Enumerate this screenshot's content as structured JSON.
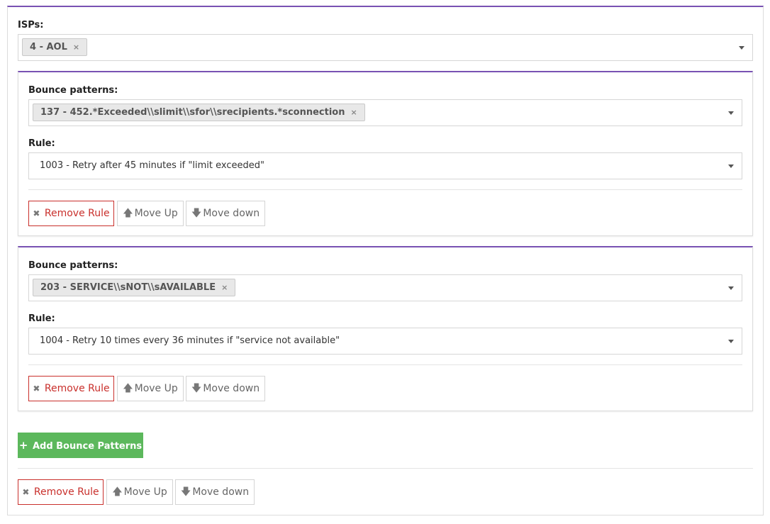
{
  "isps": {
    "label": "ISPs:",
    "tags": [
      {
        "text": "4 - AOL",
        "remove": "×"
      }
    ]
  },
  "rules": [
    {
      "patterns_label": "Bounce patterns:",
      "pattern_tag": "137 - 452.*Exceeded\\\\slimit\\\\sfor\\\\srecipients.*sconnection",
      "rule_label": "Rule:",
      "rule_value": "1003 - Retry after 45 minutes if \"limit exceeded\"",
      "remove_label": "Remove Rule",
      "move_up_label": "Move Up",
      "move_down_label": "Move down"
    },
    {
      "patterns_label": "Bounce patterns:",
      "pattern_tag": "203 - SERVICE\\\\sNOT\\\\sAVAILABLE",
      "rule_label": "Rule:",
      "rule_value": "1004 - Retry 10 times every 36 minutes if \"service not available\"",
      "remove_label": "Remove Rule",
      "move_up_label": "Move Up",
      "move_down_label": "Move down"
    }
  ],
  "add_button_label": "Add Bounce Patterns",
  "outer_actions": {
    "remove_label": "Remove Rule",
    "move_up_label": "Move Up",
    "move_down_label": "Move down"
  },
  "icons": {
    "remove": "✖",
    "up": "🡅",
    "down": "🡇",
    "plus": "+",
    "tag_remove": "×"
  },
  "colors": {
    "accent": "#7952b3",
    "danger": "#c9302c",
    "success": "#5cb85c"
  }
}
